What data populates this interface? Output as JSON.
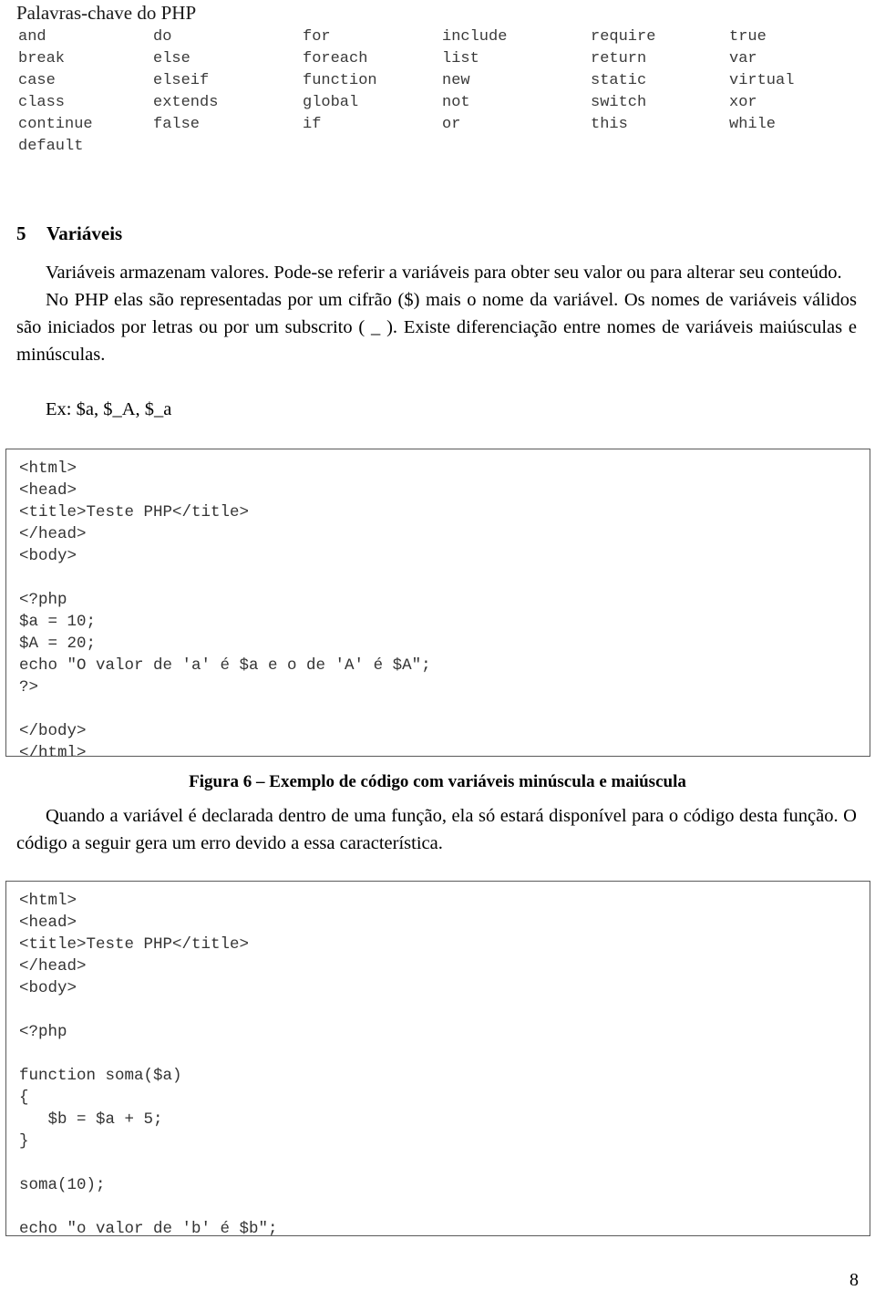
{
  "keywords_section": {
    "title": "Palavras-chave do PHP",
    "rows": [
      [
        "and",
        "do",
        "for",
        "include",
        "require",
        "true"
      ],
      [
        "break",
        "else",
        "foreach",
        "list",
        "return",
        "var"
      ],
      [
        "case",
        "elseif",
        "function",
        "new",
        "static",
        "virtual"
      ],
      [
        "class",
        "extends",
        "global",
        "not",
        "switch",
        "xor"
      ],
      [
        "continue",
        "false",
        "if",
        "or",
        "this",
        "while"
      ],
      [
        "default",
        "",
        "",
        "",
        "",
        ""
      ]
    ]
  },
  "section": {
    "number": "5",
    "title": "Variáveis"
  },
  "intro": {
    "p1": "Variáveis armazenam valores. Pode-se referir a variáveis para obter seu valor ou para alterar seu conteúdo.",
    "p2": "No PHP elas são representadas por um cifrão ($) mais o nome da variável. Os nomes de variáveis válidos são iniciados por letras ou por um subscrito ( _ ). Existe diferenciação entre nomes de variáveis maiúsculas e minúsculas.",
    "example_line": "Ex: $a, $_A, $_a"
  },
  "code_block_1": "<html>\n<head>\n<title>Teste PHP</title>\n</head>\n<body>\n\n<?php\n$a = 10;\n$A = 20;\necho \"O valor de 'a' é $a e o de 'A' é $A\";\n?>\n\n</body>\n</html>",
  "figure_caption": "Figura 6 – Exemplo de código com variáveis minúscula e maiúscula",
  "scope_paragraph": "Quando a variável é declarada dentro de uma função, ela só estará disponível para o código desta função. O código a seguir gera um erro devido a essa característica.",
  "code_block_2": "<html>\n<head>\n<title>Teste PHP</title>\n</head>\n<body>\n\n<?php\n\nfunction soma($a)\n{\n   $b = $a + 5;\n}\n\nsoma(10);\n\necho \"o valor de 'b' é $b\";",
  "page_number": "8"
}
